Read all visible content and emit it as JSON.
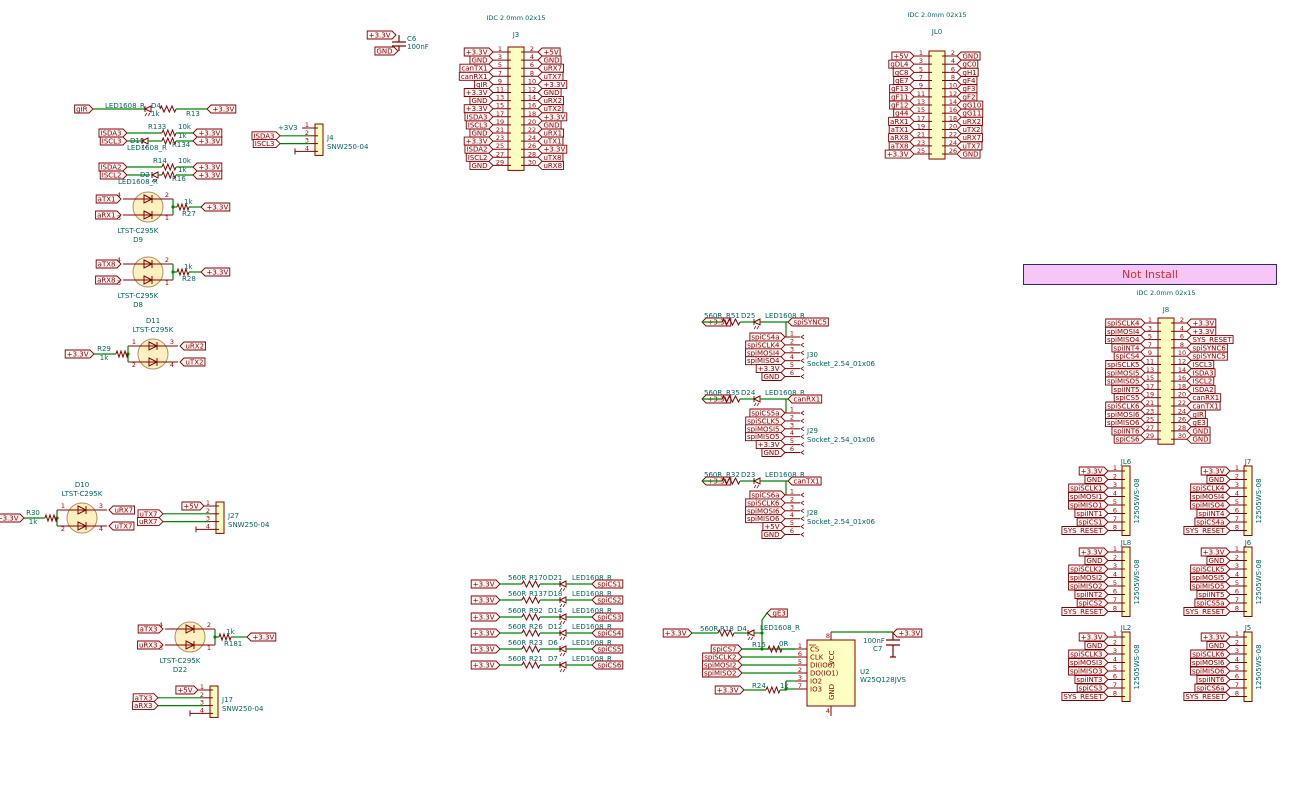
{
  "colors": {
    "wire": "#008400",
    "pin": "#840000",
    "label_text": "#840000",
    "label_fill": "#fff5f5",
    "component_text": "#006464",
    "body_fill": "#ffffc2",
    "not_install_fill": "#f6c6f6"
  },
  "not_install": {
    "text": "Not Install"
  },
  "dual": {
    "J3": {
      "title": "IDC 2.0mm 02x15",
      "ref": "J3",
      "left": [
        "+3.3V",
        "GND",
        "canTX1",
        "canRX1",
        "gIR",
        "+3.3V",
        "GND",
        "+3.3V",
        "ISDA3",
        "ISCL3",
        "GND",
        "+3.3V",
        "ISDA2",
        "ISCL2",
        "GND"
      ],
      "right": [
        "+5V",
        "GND",
        "uRX7",
        "uTX7",
        "+3.3V",
        "GND",
        "uRX2",
        "uTX2",
        "+3.3V",
        "GND",
        "uRX1",
        "uTX1",
        "+3.3V",
        "uTX8",
        "uRX8"
      ]
    },
    "JL0": {
      "title": "IDC 2.0mm 02x15",
      "ref": "JL0",
      "left": [
        "+5V",
        "gDL4",
        "gC8",
        "gE7",
        "gF13",
        "gF11",
        "gF12",
        "g44",
        "aRX1",
        "aTX1",
        "aRX8",
        "aTX8",
        "+3.3V"
      ],
      "right": [
        "GND",
        "gC0",
        "gH1",
        "gF4",
        "gF3",
        "gF2",
        "gG10",
        "gG11",
        "uRX2",
        "uTX2",
        "uRX7",
        "uTX7",
        "GND"
      ]
    },
    "J8": {
      "title": "IDC 2.0mm 02x15",
      "ref": "J8",
      "left": [
        "spiSCLK4",
        "spiMOSI4",
        "spiMISO4",
        "spiINT4",
        "spiCS4",
        "spiSCLK5",
        "spiMOSI5",
        "spiMISO5",
        "spiINT5",
        "spiCS5",
        "spiSCLK6",
        "spiMOSI6",
        "spiMISO6",
        "spiINT6",
        "spiCS6"
      ],
      "right": [
        "+3.3V",
        "+3.3V",
        "SYS_RESET",
        "spiSYNC6",
        "spiSYNC5",
        "ISCL3",
        "ISDA3",
        "ISCL2",
        "ISDA2",
        "canRX1",
        "canTX1",
        "gIR",
        "gE3",
        "GND",
        "GND"
      ]
    }
  },
  "single8": {
    "JL6": {
      "ref": "JL6",
      "value": "12505WS-08",
      "pins": [
        "+3.3V",
        "GND",
        "spiSCLK1",
        "spiMOSI1",
        "spiMISO1",
        "spiINT1",
        "spiCS1",
        "SYS_RESET"
      ]
    },
    "J7": {
      "ref": "J7",
      "value": "12505WS-08",
      "pins": [
        "+3.3V",
        "GND",
        "spiSCLK4",
        "spiMOSI4",
        "spiMISO4",
        "spiINT4",
        "spiCS4a",
        "SYS_RESET"
      ]
    },
    "JL8": {
      "ref": "JL8",
      "value": "12505WS-08",
      "pins": [
        "+3.3V",
        "GND",
        "spiSCLK2",
        "spiMOSI2",
        "spiMISO2",
        "spiINT2",
        "spiCS2",
        "SYS_RESET"
      ]
    },
    "J6": {
      "ref": "J6",
      "value": "12505WS-08",
      "pins": [
        "+3.3V",
        "GND",
        "spiSCLK5",
        "spiMOSI5",
        "spiMISO5",
        "spiINT5",
        "spiCS5a",
        "SYS_RESET"
      ]
    },
    "JL2": {
      "ref": "JL2",
      "value": "12505WS-08",
      "pins": [
        "+3.3V",
        "GND",
        "spiSCLK3",
        "spiMOSI3",
        "spiMISO3",
        "spiINT3",
        "spiCS3",
        "SYS_RESET"
      ]
    },
    "J5": {
      "ref": "J5",
      "value": "12505WS-08",
      "pins": [
        "+3.3V",
        "GND",
        "spiSCLK6",
        "spiMOSI6",
        "spiMISO6",
        "spiINT6",
        "spiCS6a",
        "SYS_RESET"
      ]
    }
  },
  "sockets": {
    "J30": {
      "ref": "J30",
      "value": "Socket_2.54_01x06",
      "pins": [
        "spiCS4a",
        "spiSCLK4",
        "spiMOSI4",
        "spiMISO4",
        "+3.3V",
        "GND"
      ],
      "led": {
        "supply": "+3.3V",
        "r_value": "560R",
        "r_ref": "R51",
        "d_ref": "D25",
        "d_value": "LED1608_R",
        "net": "spiSYNC5"
      }
    },
    "J29": {
      "ref": "J29",
      "value": "Socket_2.54_01x06",
      "pins": [
        "spiCS5a",
        "spiSCLK5",
        "spiMOSI5",
        "spiMISO5",
        "+3.3V",
        "GND"
      ],
      "led": {
        "supply": "+3.3V",
        "r_value": "560R",
        "r_ref": "R35",
        "d_ref": "D24",
        "d_value": "LED1608_R",
        "net": "canRX1"
      }
    },
    "J28": {
      "ref": "J28",
      "value": "Socket_2.54_01x06",
      "pins": [
        "spiCS6a",
        "spiSCLK6",
        "spiMOSI6",
        "spiMISO6",
        "+5V",
        "GND"
      ],
      "led": {
        "supply": "+3.3V",
        "r_value": "560R",
        "r_ref": "R32",
        "d_ref": "D23",
        "d_value": "LED1608_R",
        "net": "canTX1"
      }
    }
  },
  "snw": {
    "J4": {
      "ref": "J4",
      "value": "SNW250-04",
      "pins": [
        "+3V3",
        "ISDA3",
        "ISCL3"
      ]
    },
    "J27": {
      "ref": "J27",
      "value": "SNW250-04",
      "pins": [
        "+5V",
        "uTX7",
        "uRX7"
      ]
    },
    "J17": {
      "ref": "J17",
      "value": "SNW250-04",
      "pins": [
        "+5V",
        "aTX3",
        "aRX3"
      ]
    }
  },
  "led_rows": [
    {
      "supply": "+3.3V",
      "r_value": "560R",
      "r_ref": "R170",
      "d_ref": "D21",
      "d_value": "LED1608_R",
      "net": "spiCS1"
    },
    {
      "supply": "+3.3V",
      "r_value": "560R",
      "r_ref": "R137",
      "d_ref": "D18",
      "d_value": "LED1608_R",
      "net": "spiCS2"
    },
    {
      "supply": "+3.3V",
      "r_value": "560R",
      "r_ref": "R92",
      "d_ref": "D14",
      "d_value": "LED1608_R",
      "net": "spiCS3"
    },
    {
      "supply": "+3.3V",
      "r_value": "560R",
      "r_ref": "R26",
      "d_ref": "D12",
      "d_value": "LED1608_R",
      "net": "spiCS4"
    },
    {
      "supply": "+3.3V",
      "r_value": "560R",
      "r_ref": "R23",
      "d_ref": "D6",
      "d_value": "LED1608_R",
      "net": "spiCS5"
    },
    {
      "supply": "+3.3V",
      "r_value": "560R",
      "r_ref": "R21",
      "d_ref": "D7",
      "d_value": "LED1608_R",
      "net": "spiCS6"
    }
  ],
  "i2c_leds": {
    "gir": {
      "net": "gIR",
      "d_value": "LED1608_R",
      "d_ref": "D4",
      "r_value": "1k",
      "r_ref": "R13",
      "supply": "+3.3V"
    },
    "i2c3": {
      "sda": "ISDA3",
      "scl": "ISCL3",
      "r1_ref": "R133",
      "r1_value": "10k",
      "r2_value": "1k",
      "r2_ref": "R134",
      "d_ref": "D10",
      "d_value": "LED1608_R",
      "supply": "+3.3V"
    },
    "i2c2": {
      "sda": "ISDA2",
      "scl": "ISCL2",
      "r1_ref": "R14",
      "r1_value": "10k",
      "r2_value": "1k",
      "r2_ref": "R16",
      "d_ref": "D2",
      "d_value": "LED1608_R",
      "supply": "+3.3V"
    }
  },
  "bicolor": {
    "D9": {
      "ref": "D9",
      "value": "LTST-C295K",
      "in_a": "aTX1",
      "in_b": "aRX1",
      "r_value": "1k",
      "r_ref": "R27",
      "supply": "+3.3V"
    },
    "D8": {
      "ref": "D8",
      "value": "LTST-C295K",
      "in_a": "aTX8",
      "in_b": "aRX8",
      "r_value": "1k",
      "r_ref": "R28",
      "supply": "+3.3V"
    },
    "D11": {
      "ref": "D11",
      "value": "LTST-C295K",
      "out_a": "uRX2",
      "out_b": "uTX2",
      "r_value": "1k",
      "r_ref": "R29",
      "supply": "+3.3V"
    },
    "D10": {
      "ref": "D10",
      "value": "LTST-C295K",
      "out_a": "uRX7",
      "out_b": "uTX7",
      "r_value": "1k",
      "r_ref": "R30",
      "supply": "+3.3V"
    },
    "D22": {
      "ref": "D22",
      "value": "LTST-C295K",
      "in_a": "aTX3",
      "in_b": "uRX3",
      "r_value": "1k",
      "r_ref": "R181",
      "supply": "+3.3V"
    }
  },
  "c6": {
    "ref": "C6",
    "value": "100nF",
    "supply": "+3.3V",
    "gnd": "GND"
  },
  "u2": {
    "ref": "U2",
    "value": "W25Q128JVS",
    "pins": [
      {
        "num": "1",
        "name": "CS",
        "net": "spiCS7"
      },
      {
        "num": "6",
        "name": "CLK",
        "net": "spiSCLK2"
      },
      {
        "num": "5",
        "name": "DI(IO0)",
        "net": "spiMOSI2"
      },
      {
        "num": "2",
        "name": "DO(IO1)",
        "net": "spiMISO2"
      },
      {
        "num": "3",
        "name": "IO2"
      },
      {
        "num": "7",
        "name": "IO3"
      }
    ],
    "vcc": "VCC",
    "vcc_num": "8",
    "gnd": "GND",
    "gnd_num": "4",
    "r15_ref": "R15",
    "r15_value": "0R",
    "r24_ref": "R24",
    "r24_value": "1k",
    "r24_supply": "+3.3V",
    "led": {
      "supply": "+3.3V",
      "r_value": "560R",
      "r_ref": "R18",
      "d_ref": "D4",
      "d_value": "LED1608_R",
      "net": "gE3"
    },
    "c7_ref": "C7",
    "c7_value": "100nF",
    "c7_supply": "+3.3V"
  }
}
